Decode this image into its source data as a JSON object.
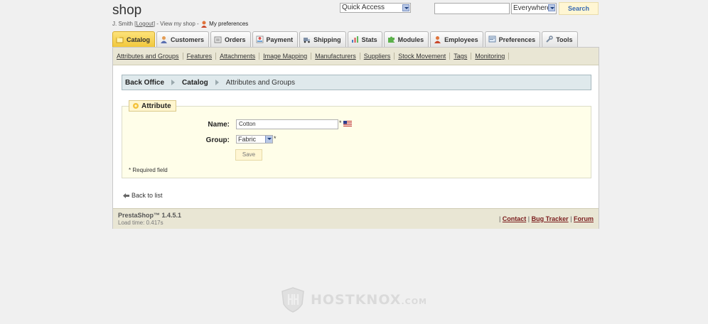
{
  "header": {
    "shop_name": "shop",
    "user_name": "J. Smith",
    "logout_label": "Logout",
    "view_shop_label": "View my shop",
    "preferences_label": "My preferences"
  },
  "top_controls": {
    "quick_access_value": "Quick Access",
    "search_value": "",
    "search_scope_value": "Everywhere",
    "search_button_label": "Search"
  },
  "tabs": [
    {
      "label": "Catalog",
      "icon": "folder-icon",
      "active": true
    },
    {
      "label": "Customers",
      "icon": "customer-icon"
    },
    {
      "label": "Orders",
      "icon": "orders-icon"
    },
    {
      "label": "Payment",
      "icon": "payment-icon"
    },
    {
      "label": "Shipping",
      "icon": "truck-icon"
    },
    {
      "label": "Stats",
      "icon": "stats-icon"
    },
    {
      "label": "Modules",
      "icon": "puzzle-icon"
    },
    {
      "label": "Employees",
      "icon": "employee-icon"
    },
    {
      "label": "Preferences",
      "icon": "preferences-icon"
    },
    {
      "label": "Tools",
      "icon": "wrench-icon"
    }
  ],
  "subnav": [
    "Attributes and Groups",
    "Features",
    "Attachments",
    "Image Mapping",
    "Manufacturers",
    "Suppliers",
    "Stock Movement",
    "Tags",
    "Monitoring"
  ],
  "breadcrumb": {
    "root": "Back Office",
    "section": "Catalog",
    "current": "Attributes and Groups"
  },
  "form": {
    "legend": "Attribute",
    "name_label": "Name:",
    "name_value": "Cotton",
    "required_mark": "*",
    "group_label": "Group:",
    "group_value": "Fabric",
    "save_label": "Save",
    "required_note": "* Required field"
  },
  "back_link_label": "Back to list",
  "footer": {
    "version": "PrestaShop™ 1.4.5.1",
    "load_time": "Load time: 0.417s",
    "links": [
      "Contact",
      "Bug Tracker",
      "Forum"
    ]
  },
  "watermark": {
    "brand": "HOSTKNOX",
    "suffix": ".COM"
  },
  "colors": {
    "active_tab": "#f1c83b",
    "subnav_bg": "#e9e6d4",
    "breadcrumb_bg": "#dfe9ec",
    "form_bg": "#fffee9",
    "footer_link": "#7a1c1c"
  }
}
